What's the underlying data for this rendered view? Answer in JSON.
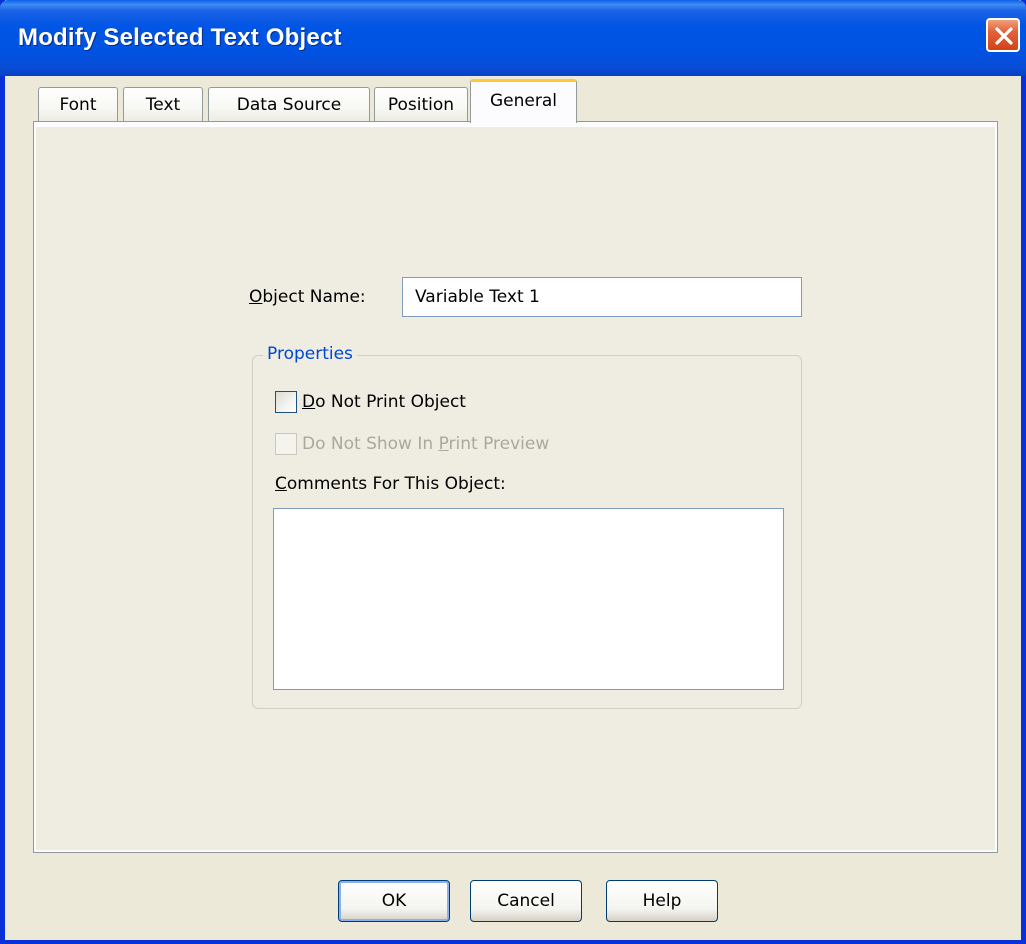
{
  "window": {
    "title": "Modify Selected Text Object"
  },
  "tabs": [
    {
      "label": "Font",
      "active": false
    },
    {
      "label": "Text",
      "active": false
    },
    {
      "label": "Data Source",
      "active": false
    },
    {
      "label": "Position",
      "active": false
    },
    {
      "label": "General",
      "active": true
    }
  ],
  "general": {
    "object_name_label": "Object Name:",
    "object_name_value": "Variable Text 1",
    "properties_title": "Properties",
    "do_not_print_label": "Do Not Print Object",
    "do_not_print_checked": false,
    "do_not_show_preview_label": "Do Not Show In Print Preview",
    "do_not_show_preview_checked": false,
    "do_not_show_preview_enabled": false,
    "comments_label": "Comments For This Object:",
    "comments_value": ""
  },
  "buttons": {
    "ok": "OK",
    "cancel": "Cancel",
    "help": "Help"
  },
  "colors": {
    "titlebar": "#0055e5",
    "window_bg": "#ece9d8",
    "group_title": "#0046d5",
    "active_tab_accent": "#ffc83c"
  },
  "icons": {
    "close": "close-icon",
    "scroll_up": "chevron-up-icon",
    "scroll_down": "chevron-down-icon"
  }
}
